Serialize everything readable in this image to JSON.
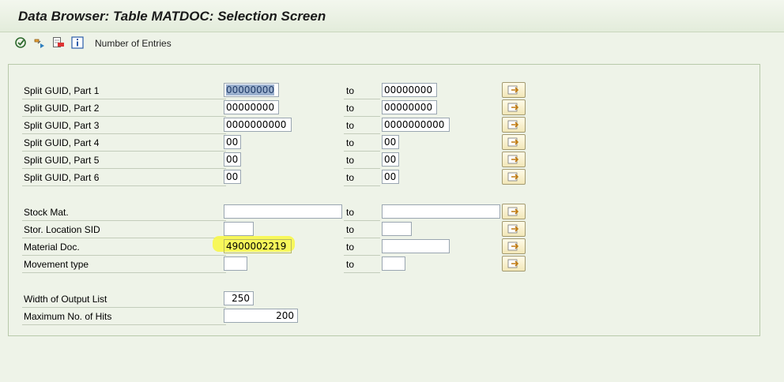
{
  "window": {
    "title": "Data Browser: Table MATDOC: Selection Screen"
  },
  "toolbar": {
    "execute_icon": "execute-icon",
    "multiple_icon": "multiple-selection-icon",
    "delete_icon": "delete-selection-icon",
    "info_icon": "info-icon",
    "number_of_entries": "Number of Entries"
  },
  "fields": {
    "to_label": "to",
    "rows": [
      {
        "label": "Split GUID, Part 1",
        "low": "00000000",
        "high": "00000000"
      },
      {
        "label": "Split GUID, Part 2",
        "low": "00000000",
        "high": "00000000"
      },
      {
        "label": "Split GUID, Part 3",
        "low": "0000000000",
        "high": "0000000000"
      },
      {
        "label": "Split GUID, Part 4",
        "low": "00",
        "high": "00"
      },
      {
        "label": "Split GUID, Part 5",
        "low": "00",
        "high": "00"
      },
      {
        "label": "Split GUID, Part 6",
        "low": "00",
        "high": "00"
      },
      {
        "label": "Stock Mat.",
        "low": "",
        "high": ""
      },
      {
        "label": "Stor. Location SID",
        "low": "",
        "high": ""
      },
      {
        "label": "Material Doc.",
        "low": "4900002219",
        "high": ""
      },
      {
        "label": "Movement type",
        "low": "",
        "high": ""
      }
    ]
  },
  "settings": {
    "width_label": "Width of Output List",
    "width_value": "250",
    "max_hits_label": "Maximum No. of Hits",
    "max_hits_value": "200"
  },
  "colors": {
    "highlight": "#f7f74a",
    "selection": "#9db2cf",
    "background": "#eef3e8"
  }
}
